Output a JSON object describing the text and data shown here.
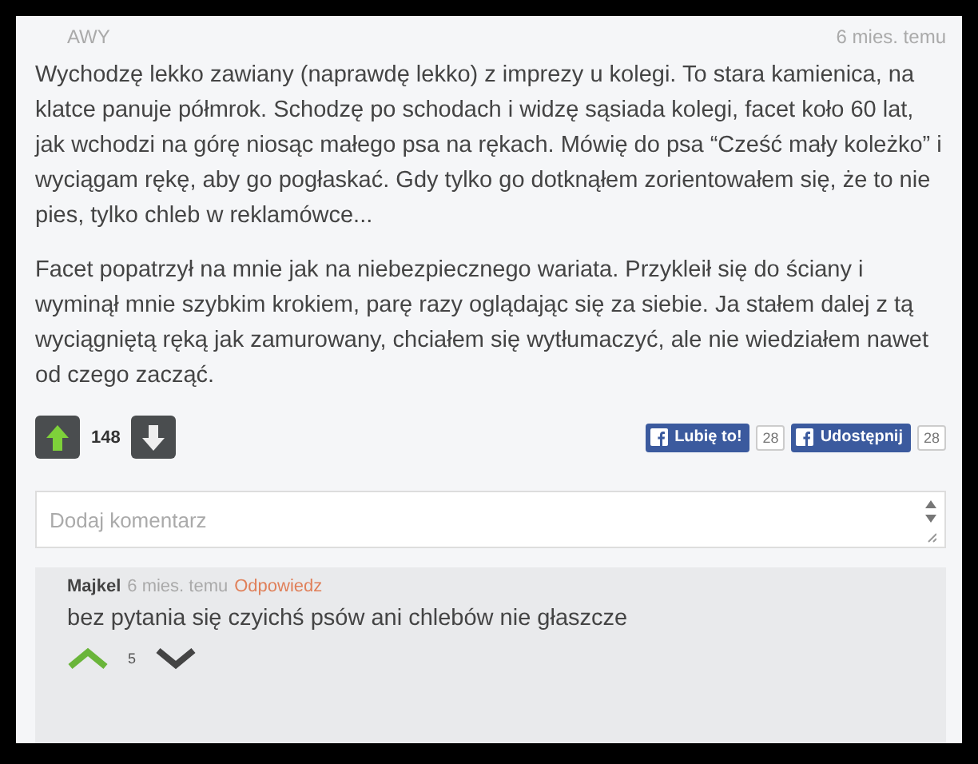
{
  "post": {
    "author": "AWY",
    "time": "6 mies. temu",
    "paragraphs": [
      "Wychodzę lekko zawiany (naprawdę lekko) z imprezy u kolegi. To stara kamienica, na klatce panuje półmrok. Schodzę po schodach i widzę sąsiada kolegi, facet koło 60 lat, jak wchodzi na górę niosąc małego psa na rękach. Mówię do psa “Cześć mały koleżko” i wyciągam rękę, aby go pogłaskać. Gdy tylko go dotknąłem zorientowałem się, że to nie pies, tylko chleb w reklamówce...",
      "Facet popatrzył na mnie jak na niebezpiecznego wariata. Przykleił się do ściany i wyminął mnie szybkim krokiem, parę razy oglądając się za siebie. Ja stałem dalej z tą wyciągniętą ręką jak zamurowany, chciałem się wytłumaczyć, ale nie wiedziałem nawet od czego zacząć."
    ],
    "score": "148",
    "share": [
      {
        "label": "Lubię to!",
        "count": "28"
      },
      {
        "label": "Udostępnij",
        "count": "28"
      }
    ]
  },
  "comment_box": {
    "placeholder": "Dodaj komentarz"
  },
  "comments": [
    {
      "author": "Majkel",
      "time": "6 mies. temu",
      "reply": "Odpowiedz",
      "text": "bez pytania się czyichś psów ani chlebów nie głaszcze",
      "score": "5"
    }
  ]
}
